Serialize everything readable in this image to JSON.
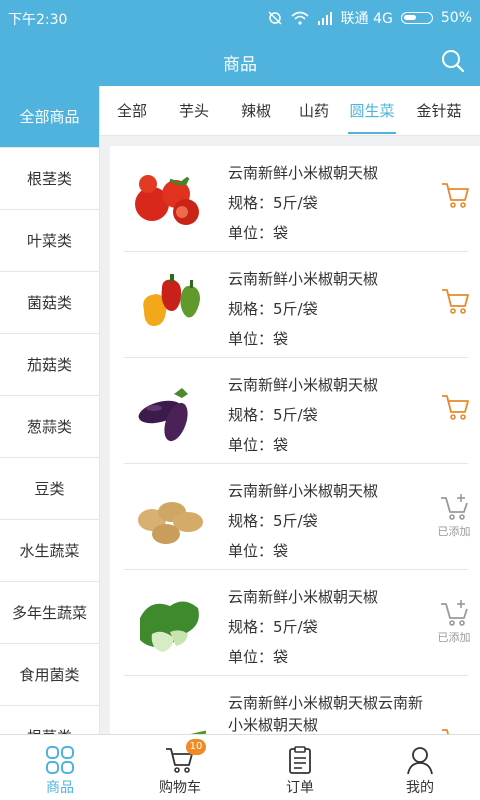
{
  "status": {
    "time": "下午2:30",
    "carrier": "联通 4G",
    "battery": "50%"
  },
  "header": {
    "title": "商品"
  },
  "sidebar": {
    "items": [
      {
        "label": "全部商品",
        "active": true
      },
      {
        "label": "根茎类"
      },
      {
        "label": "叶菜类"
      },
      {
        "label": "菌菇类"
      },
      {
        "label": "茄菇类"
      },
      {
        "label": "葱蒜类"
      },
      {
        "label": "豆类"
      },
      {
        "label": "水生蔬菜"
      },
      {
        "label": "多年生蔬菜"
      },
      {
        "label": "食用菌类"
      },
      {
        "label": "根茎类"
      }
    ]
  },
  "tabs": [
    {
      "label": "全部"
    },
    {
      "label": "芋头"
    },
    {
      "label": "辣椒"
    },
    {
      "label": "山药"
    },
    {
      "label": "圆生菜",
      "active": true
    },
    {
      "label": "金针菇"
    }
  ],
  "products": [
    {
      "name": "云南新鲜小米椒朝天椒",
      "spec": "规格：5斤/袋",
      "unit": "单位：袋",
      "image": "tomato",
      "added": false
    },
    {
      "name": "云南新鲜小米椒朝天椒",
      "spec": "规格：5斤/袋",
      "unit": "单位：袋",
      "image": "bell-pepper",
      "added": false
    },
    {
      "name": "云南新鲜小米椒朝天椒",
      "spec": "规格：5斤/袋",
      "unit": "单位：袋",
      "image": "eggplant",
      "added": false
    },
    {
      "name": "云南新鲜小米椒朝天椒",
      "spec": "规格：5斤/袋",
      "unit": "单位：袋",
      "image": "potato",
      "added": true,
      "added_label": "已添加"
    },
    {
      "name": "云南新鲜小米椒朝天椒",
      "spec": "规格：5斤/袋",
      "unit": "单位：袋",
      "image": "bok-choy",
      "added": true,
      "added_label": "已添加"
    },
    {
      "name": "云南新鲜小米椒朝天椒云南新小米椒朝天椒",
      "spec": "",
      "unit": "",
      "image": "scallion",
      "added": false
    }
  ],
  "bottom_nav": {
    "goods": "商品",
    "cart": "购物车",
    "cart_badge": "10",
    "orders": "订单",
    "mine": "我的"
  },
  "colors": {
    "accent": "#4fb3dd",
    "cart_orange": "#e8892b",
    "added_gray": "#999999",
    "badge": "#f08a24"
  }
}
